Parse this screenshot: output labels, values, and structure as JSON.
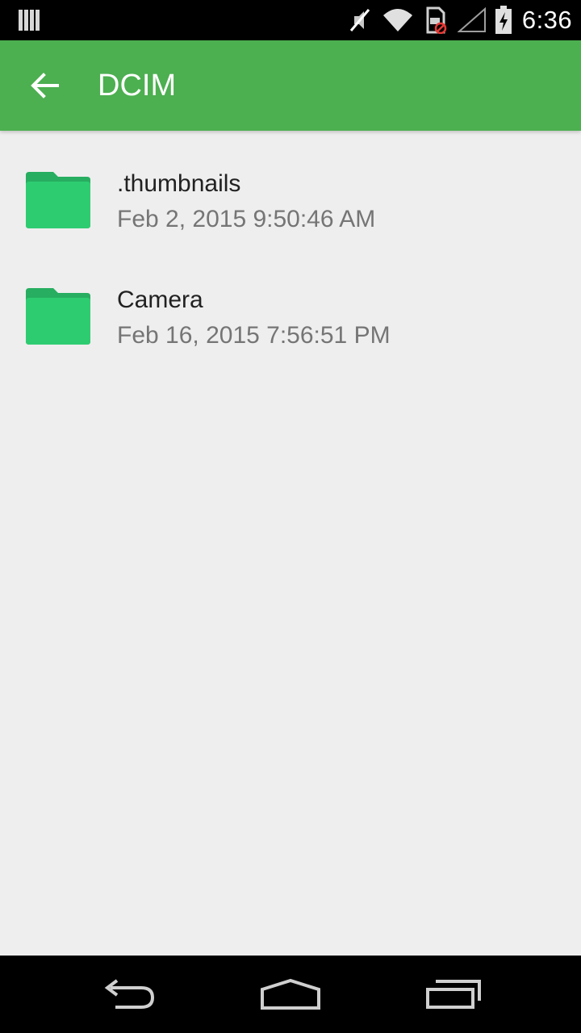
{
  "status_bar": {
    "time": "6:36",
    "icons": [
      "notification-bars-icon",
      "mute-icon",
      "wifi-icon",
      "sim-error-icon",
      "signal-icon",
      "battery-charging-icon"
    ]
  },
  "app_bar": {
    "title": "DCIM",
    "back_icon": "arrow-back-icon",
    "color": "#4caf50"
  },
  "files": [
    {
      "name": ".thumbnails",
      "date": "Feb 2, 2015 9:50:46 AM",
      "icon": "folder-icon"
    },
    {
      "name": "Camera",
      "date": "Feb 16, 2015 7:56:51 PM",
      "icon": "folder-icon"
    }
  ],
  "nav_bar": {
    "buttons": [
      "back-nav-icon",
      "home-nav-icon",
      "recents-nav-icon"
    ]
  },
  "colors": {
    "accent": "#4caf50",
    "folder": "#2ecc71",
    "background": "#eeeeee"
  }
}
